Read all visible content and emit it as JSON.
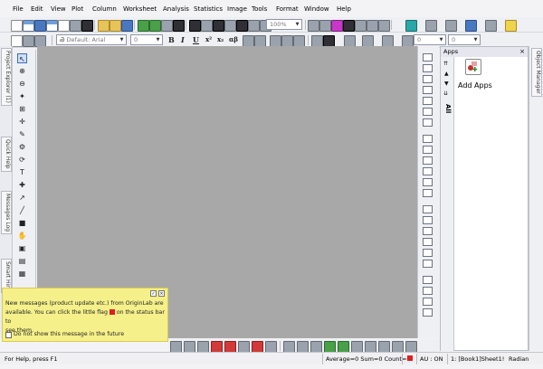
{
  "menu": [
    "File",
    "Edit",
    "View",
    "Plot",
    "Column",
    "Worksheet",
    "Analysis",
    "Statistics",
    "Image",
    "Tools",
    "Format",
    "Window",
    "Help"
  ],
  "toolbar": {
    "zoom_value": "100%",
    "font_value": "Default: Arial",
    "font_size_value": "0",
    "second_size_value": "0",
    "third_size_value": "0",
    "bold_label": "B",
    "italic_label": "I",
    "underline_label": "U"
  },
  "left_dock": {
    "tabs": [
      "Project Explorer (1)",
      "Quick Help",
      "Messages Log",
      "Smart Hint"
    ]
  },
  "left_tools": {
    "text_tool": "T"
  },
  "apps": {
    "title": "Apps",
    "tab_label": "All",
    "add_apps_label": "Add Apps"
  },
  "right_dock": {
    "tab_label": "Object Manager"
  },
  "notice": {
    "message_line1": "New messages (product update etc.) from OriginLab are",
    "message_line2a": "available. You can click the little flag",
    "message_line2b": "on the status bar to",
    "message_line3": "see them.",
    "checkbox_label": "Do not show this message in the future"
  },
  "status": {
    "help_text": "For Help, press F1",
    "stats_text": "Average=0 Sum=0 Count=0",
    "au_text": "AU : ON",
    "sheet_text": "1: [Book1]Sheet1!",
    "angle_text": "Radian"
  },
  "colors": {
    "workspace": "#a8a8a8",
    "notice_bg": "#f6f08a",
    "flag": "#e01e1e",
    "selection_blue": "#3a6fbf"
  }
}
